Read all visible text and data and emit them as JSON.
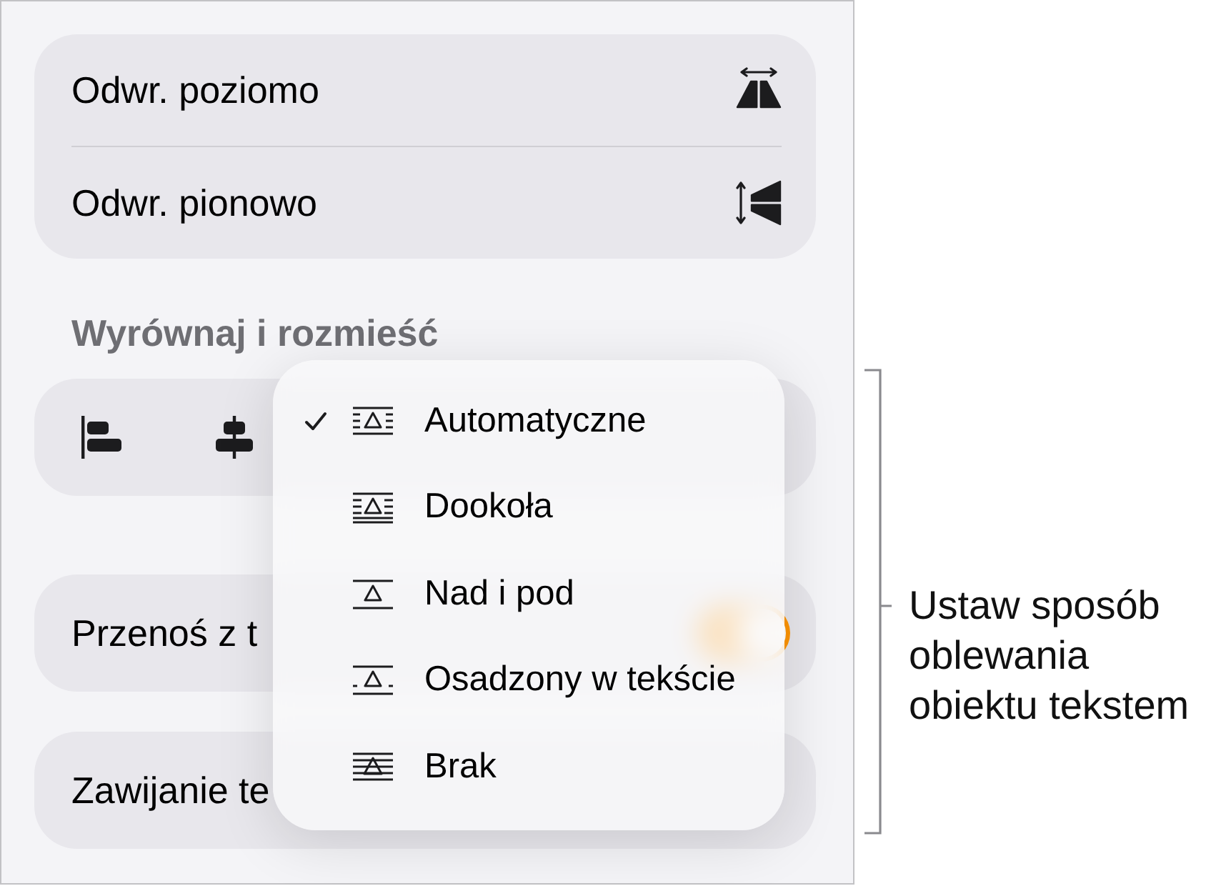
{
  "panel": {
    "flip_rows": [
      {
        "label": "Odwr. poziomo",
        "kind": "horizontal"
      },
      {
        "label": "Odwr. pionowo",
        "kind": "vertical"
      }
    ],
    "section_header": "Wyrównaj i rozmieść",
    "align_buttons": [
      {
        "kind": "left"
      },
      {
        "kind": "center"
      }
    ],
    "move_with_text": {
      "label": "Przenoś z t",
      "on": true
    },
    "wrap_row": {
      "label": "Zawijanie te"
    }
  },
  "wrap_menu": {
    "items": [
      {
        "label": "Automatyczne",
        "kind": "automatic",
        "selected": true
      },
      {
        "label": "Dookoła",
        "kind": "around",
        "selected": false
      },
      {
        "label": "Nad i pod",
        "kind": "above_below",
        "selected": false
      },
      {
        "label": "Osadzony w tekście",
        "kind": "inline",
        "selected": false
      },
      {
        "label": "Brak",
        "kind": "none",
        "selected": false
      }
    ]
  },
  "callout": {
    "text": "Ustaw sposób oblewania obiektu tekstem"
  }
}
